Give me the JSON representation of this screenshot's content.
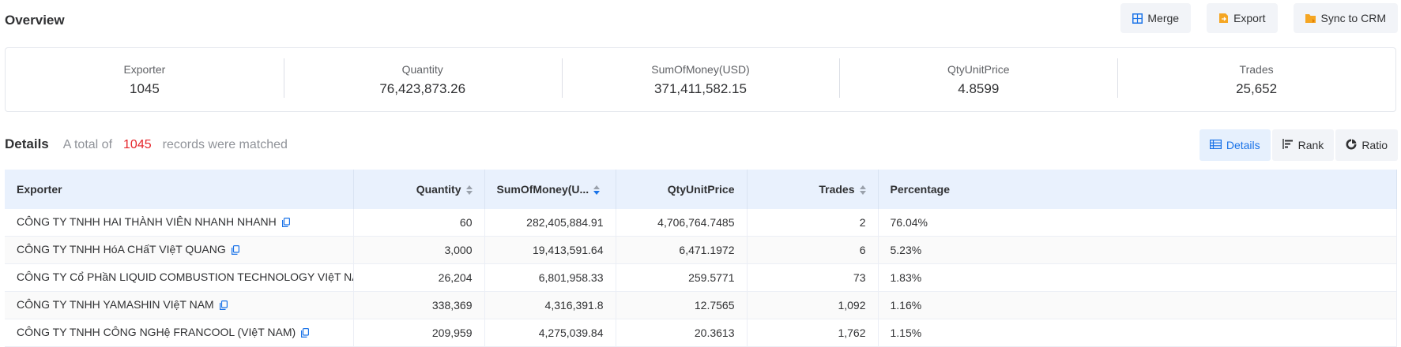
{
  "header": {
    "title": "Overview",
    "buttons": {
      "merge": "Merge",
      "export": "Export",
      "sync": "Sync to CRM"
    }
  },
  "summary": [
    {
      "label": "Exporter",
      "value": "1045"
    },
    {
      "label": "Quantity",
      "value": "76,423,873.26"
    },
    {
      "label": "SumOfMoney(USD)",
      "value": "371,411,582.15"
    },
    {
      "label": "QtyUnitPrice",
      "value": "4.8599"
    },
    {
      "label": "Trades",
      "value": "25,652"
    }
  ],
  "details": {
    "title": "Details",
    "prefix": "A total of",
    "count": "1045",
    "suffix": "records were matched",
    "views": {
      "details": "Details",
      "rank": "Rank",
      "ratio": "Ratio"
    }
  },
  "table": {
    "columns": {
      "exporter": "Exporter",
      "quantity": "Quantity",
      "sum": "SumOfMoney(U...",
      "qty_price": "QtyUnitPrice",
      "trades": "Trades",
      "percentage": "Percentage"
    },
    "rows": [
      {
        "exporter": "CÔNG TY TNHH HAI THÀNH VIÊN NHANH NHANH",
        "quantity": "60",
        "sum": "282,405,884.91",
        "qty_price": "4,706,764.7485",
        "trades": "2",
        "percentage": "76.04%"
      },
      {
        "exporter": "CÔNG TY TNHH HóA CHấT VIệT QUANG",
        "quantity": "3,000",
        "sum": "19,413,591.64",
        "qty_price": "6,471.1972",
        "trades": "6",
        "percentage": "5.23%"
      },
      {
        "exporter": "CÔNG TY Cổ PHầN LIQUID COMBUSTION TECHNOLOGY VIệT NAM",
        "quantity": "26,204",
        "sum": "6,801,958.33",
        "qty_price": "259.5771",
        "trades": "73",
        "percentage": "1.83%"
      },
      {
        "exporter": "CÔNG TY TNHH YAMASHIN VIệT NAM",
        "quantity": "338,369",
        "sum": "4,316,391.8",
        "qty_price": "12.7565",
        "trades": "1,092",
        "percentage": "1.16%"
      },
      {
        "exporter": "CÔNG TY TNHH CÔNG NGHệ FRANCOOL (VIệT NAM)",
        "quantity": "209,959",
        "sum": "4,275,039.84",
        "qty_price": "20.3613",
        "trades": "1,762",
        "percentage": "1.15%"
      }
    ]
  },
  "colors": {
    "accent": "#1a73e8",
    "count": "#e5262b",
    "header_bg": "#e9f1fd",
    "button_bg": "#f2f4f8",
    "icon_orange": "#f5a623"
  }
}
